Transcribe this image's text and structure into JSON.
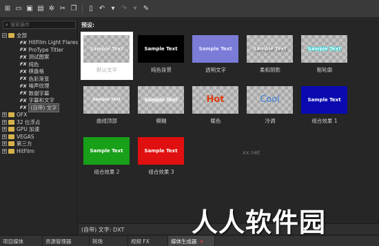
{
  "toolbar": {
    "buttons": [
      "filter-icon",
      "open-folder-icon",
      "save-icon",
      "save-as-icon",
      "settings-icon",
      "scissors-icon",
      "copy-icon",
      "delete-icon",
      "undo-icon",
      "dropdown-icon",
      "redo-icon",
      "dropdown-icon",
      "help-icon"
    ]
  },
  "search": {
    "placeholder": "搜索插件"
  },
  "tree": {
    "root": "全部",
    "items": [
      "HitFilm Light Flares",
      "ProType Titler",
      "测试图案",
      "纯色",
      "棋盘格",
      "色彩渐变",
      "噪声纹理",
      "致谢字幕",
      "字幕和文字",
      "(自带) 文字"
    ],
    "fx_tag": "FX",
    "groups": [
      "OFX",
      "32 位浮点",
      "GPU 加速",
      "VEGAS",
      "第三方",
      "HitFilm"
    ]
  },
  "presets": {
    "label": "预设:",
    "items": [
      {
        "thumb_text": "Sample Text",
        "caption": "默认文字"
      },
      {
        "thumb_text": "Sample Text",
        "caption": "纯色背景"
      },
      {
        "thumb_text": "Sample Text",
        "caption": "透明文字"
      },
      {
        "thumb_text": "Sample Text",
        "caption": "柔和阴影"
      },
      {
        "thumb_text": "Sample Text",
        "caption": "粗轮廓"
      },
      {
        "thumb_text": "Sample Text",
        "caption": "曲线顶部"
      },
      {
        "thumb_text": "Sample Text",
        "caption": "模糊"
      },
      {
        "thumb_text": "Hot",
        "caption": "暖色"
      },
      {
        "thumb_text": "Cool",
        "caption": "冷调"
      },
      {
        "thumb_text": "Sample Text",
        "caption": "组合效果 1"
      },
      {
        "thumb_text": "Sample Text",
        "caption": "组合效果 2"
      },
      {
        "thumb_text": "Sample Text",
        "caption": "组合效果 3"
      }
    ]
  },
  "status": {
    "text": "(自带) 文字: DXT"
  },
  "tabs": [
    "项目媒体",
    "资源管理器",
    "转场",
    "视频 FX",
    "媒体生成器"
  ],
  "watermark": {
    "big": "人人软件园",
    "small": "xx.net"
  },
  "colors": {
    "folder": "#d6b24c",
    "selected_bg": "#ffffff",
    "hot": "#e03a10",
    "cool": "#3a7fd8"
  }
}
